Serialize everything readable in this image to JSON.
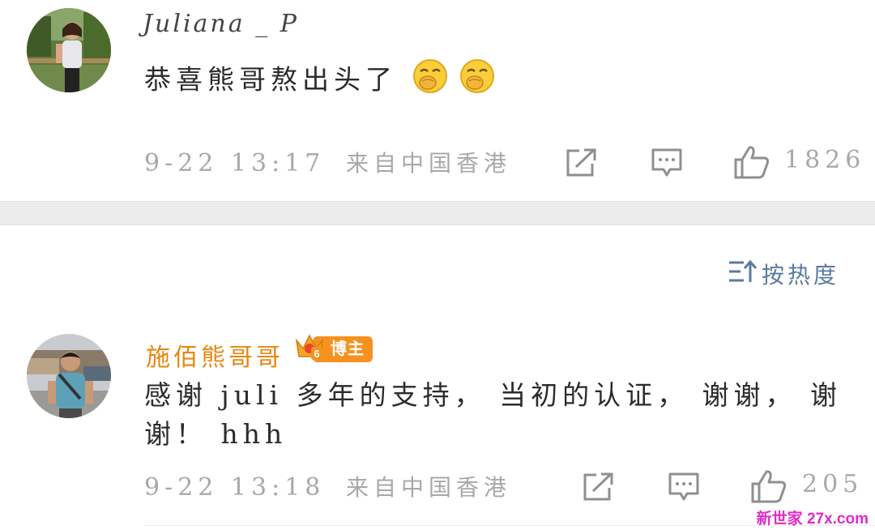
{
  "comments": [
    {
      "username": "Juliana _ P",
      "text": "恭喜熊哥熬出头了",
      "emoji": [
        "laugh-emoji",
        "laugh-emoji"
      ],
      "time": "9-22 13:17",
      "source": "来自中国香港",
      "likes": "1826"
    },
    {
      "username": "施佰熊哥哥",
      "badge": "博主",
      "badge_level": "6",
      "text_line1": "感谢 juli 多年的支持， 当初的认证， 谢谢， 谢",
      "text_line2": "谢！ hhh",
      "time": "9-22 13:18",
      "source": "来自中国香港",
      "likes": "205"
    }
  ],
  "sort": {
    "label": "按热度"
  },
  "watermark": "新世家 27x.com",
  "colors": {
    "username_highlight": "#e8860c",
    "badge": "#f5921f",
    "sort": "#5a7aa0",
    "meta": "#a8a8a8"
  }
}
